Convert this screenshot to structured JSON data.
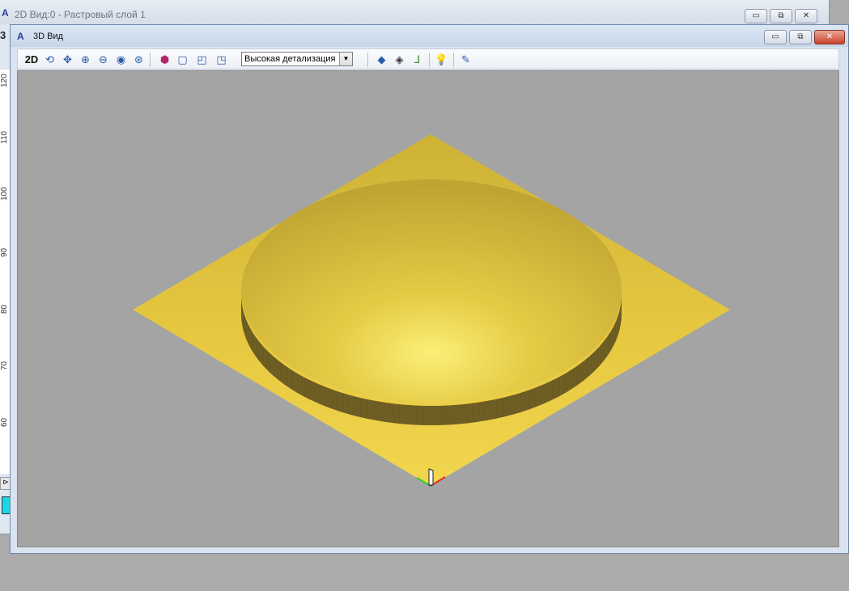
{
  "background_window": {
    "title": "2D Вид:0 - Растровый слой 1",
    "tab_fragment": "3",
    "ruler_ticks": [
      "120",
      "110",
      "100",
      "90",
      "80",
      "70",
      "60"
    ]
  },
  "window3d": {
    "title": "3D Вид",
    "buttons": {
      "minimize": "▭",
      "restore": "⧉",
      "close": "✕"
    }
  },
  "toolbar": {
    "view2d_label": "2D",
    "detail_selected": "Высокая детализация",
    "icons": [
      "rotate-icon",
      "pan-icon",
      "zoom-in-icon",
      "zoom-out-icon",
      "zoom-window-icon",
      "zoom-fit-icon",
      "iso-view-icon",
      "front-view-icon",
      "top-view-icon",
      "side-view-icon",
      "shaded-plane-icon",
      "wireframe-icon",
      "axes-icon",
      "light-bulb-icon",
      "material-icon"
    ]
  },
  "colors": {
    "viewport_bg": "#a4a4a4",
    "model_gold": "#e3c33c",
    "model_highlight": "#f7e97a",
    "model_edge": "#6f5d21"
  }
}
